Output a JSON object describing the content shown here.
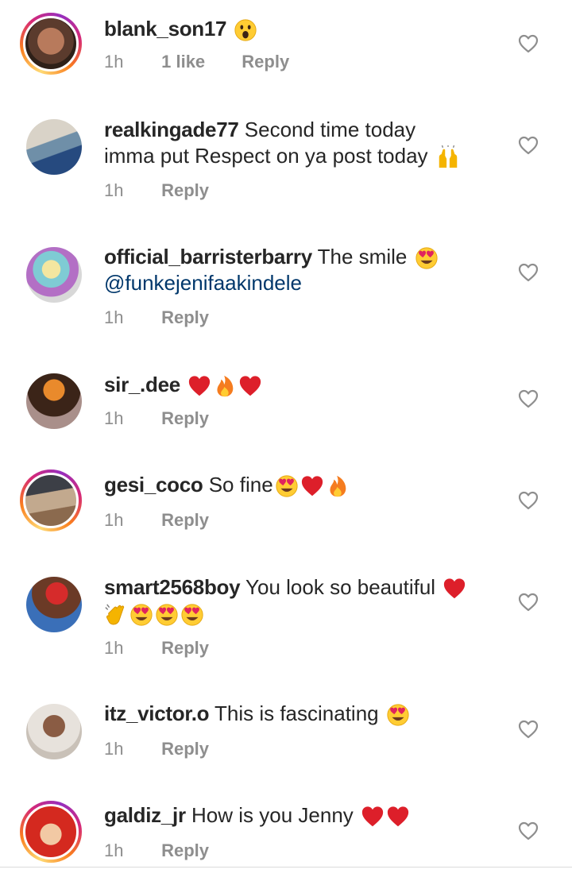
{
  "comments": [
    {
      "username": "blank_son17",
      "text": "",
      "emojis": [
        "astonished"
      ],
      "time": "1h",
      "likes": "1 like",
      "reply": "Reply",
      "mention": "",
      "text2": ""
    },
    {
      "username": "realkingade77",
      "text": "Second time today",
      "text2": "imma put Respect on ya post today",
      "emojis2": [
        "raising-hands"
      ],
      "time": "1h",
      "reply": "Reply"
    },
    {
      "username": "official_barristerbarry",
      "text": "The smile",
      "emojis": [
        "heart-eyes"
      ],
      "mention": "@funkejenifaakindele",
      "time": "1h",
      "reply": "Reply"
    },
    {
      "username": "sir_.dee",
      "text": "",
      "emojis": [
        "red-heart",
        "fire",
        "red-heart"
      ],
      "time": "1h",
      "reply": "Reply"
    },
    {
      "username": "gesi_coco",
      "text": "So fine",
      "emojis": [
        "heart-eyes",
        "red-heart",
        "fire"
      ],
      "time": "1h",
      "reply": "Reply"
    },
    {
      "username": "smart2568boy",
      "text": "You look so beautiful",
      "emojis": [
        "red-heart"
      ],
      "emojis2": [
        "clapping-hands",
        "heart-eyes",
        "heart-eyes",
        "heart-eyes"
      ],
      "time": "1h",
      "reply": "Reply"
    },
    {
      "username": "itz_victor.o",
      "text": "This is fascinating",
      "emojis": [
        "heart-eyes"
      ],
      "time": "1h",
      "reply": "Reply"
    },
    {
      "username": "galdiz_jr",
      "text": "How is you Jenny",
      "emojis": [
        "red-heart",
        "red-heart"
      ],
      "time": "1h",
      "reply": "Reply"
    }
  ],
  "colors": {
    "text": "#262626",
    "meta": "#8e8e8e",
    "mention": "#00376b"
  }
}
